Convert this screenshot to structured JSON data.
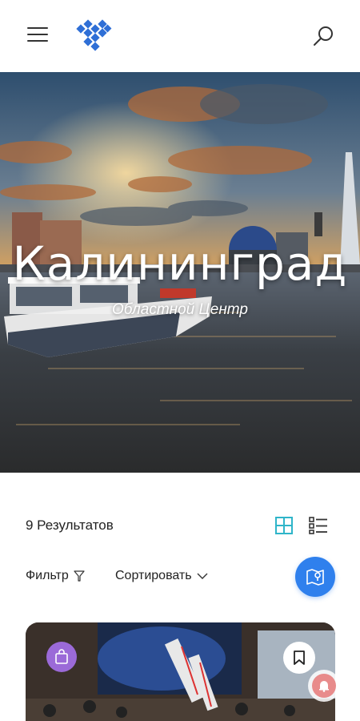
{
  "header": {
    "menu_icon": "hamburger-menu-icon",
    "logo_icon": "heart-grid-logo",
    "search_icon": "search-icon"
  },
  "hero": {
    "title": "Калининград",
    "subtitle": "Областной Центр"
  },
  "results": {
    "count_label": "9 Результатов",
    "grid_view_icon": "grid-view-icon",
    "list_view_icon": "list-view-icon",
    "active_view": "grid",
    "accent_color": "#2fb5c9"
  },
  "controls": {
    "filter_label": "Фильтр",
    "sort_label": "Сортировать",
    "map_button_color": "#2f80ed"
  },
  "card": {
    "badge_icon": "shopping-bag-icon",
    "badge_color": "#9b6ad8",
    "bookmark_icon": "bookmark-icon"
  },
  "notification": {
    "icon": "bell-icon"
  }
}
